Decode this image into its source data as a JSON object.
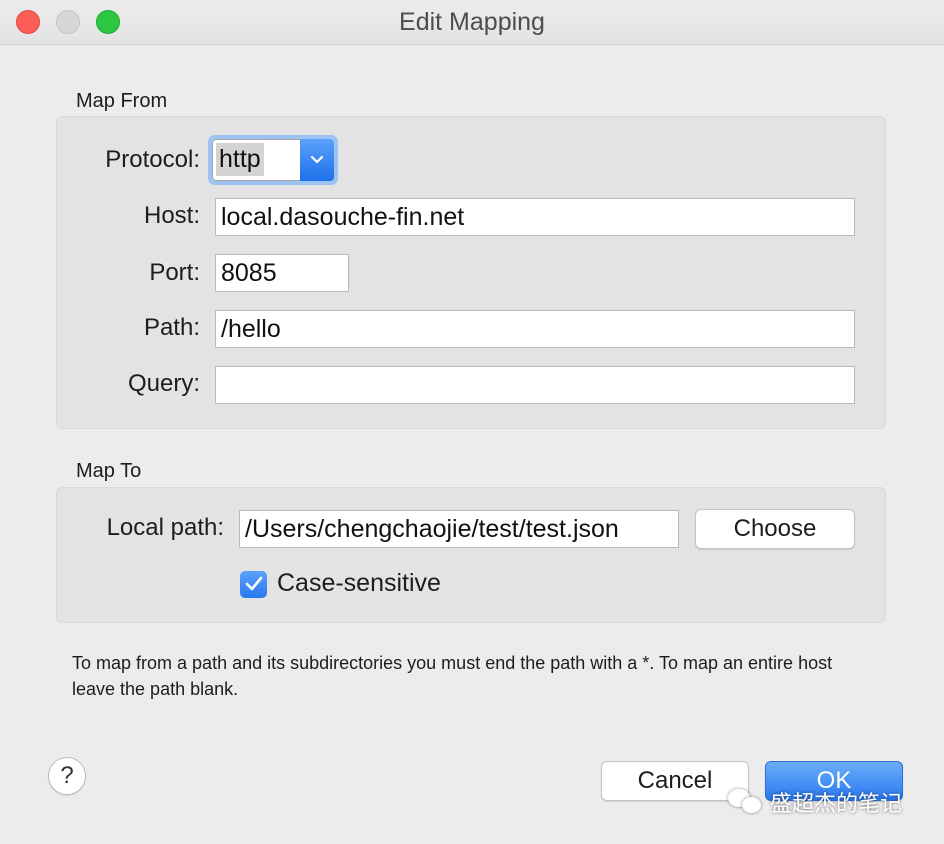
{
  "window": {
    "title": "Edit Mapping"
  },
  "map_from": {
    "section_label": "Map From",
    "protocol": {
      "label": "Protocol:",
      "value": "http"
    },
    "host": {
      "label": "Host:",
      "value": "local.dasouche-fin.net"
    },
    "port": {
      "label": "Port:",
      "value": "8085"
    },
    "path": {
      "label": "Path:",
      "value": "/hello"
    },
    "query": {
      "label": "Query:",
      "value": ""
    }
  },
  "map_to": {
    "section_label": "Map To",
    "local_path": {
      "label": "Local path:",
      "value": "/Users/chengchaojie/test/test.json"
    },
    "choose_label": "Choose",
    "case_sensitive": {
      "label": "Case-sensitive",
      "checked": true
    }
  },
  "hint": "To map from a path and its subdirectories you must end the path with a *. To map an entire host leave the path blank.",
  "buttons": {
    "help": "?",
    "cancel": "Cancel",
    "ok": "OK"
  },
  "watermark": {
    "text": "盛超杰的笔记",
    "icon": "wechat-icon"
  },
  "icons": {
    "popup_arrow": "chevron-down-icon",
    "check": "checkmark-icon"
  },
  "colors": {
    "accent": "#2a78f0",
    "close": "#fc5f57",
    "maximize": "#2cc740"
  }
}
